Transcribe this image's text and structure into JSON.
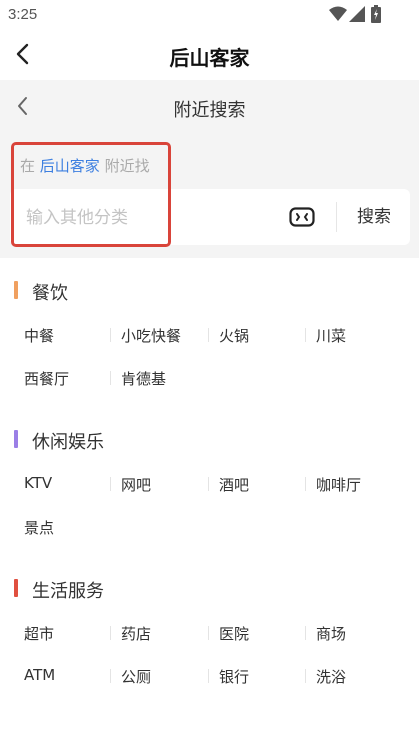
{
  "status_bar": {
    "time": "3:25",
    "icons": [
      "wifi-icon",
      "signal-icon",
      "battery-icon"
    ]
  },
  "title_bar": {
    "title": "后山客家",
    "back_icon": "chevron-left-icon"
  },
  "sub_header": {
    "title": "附近搜索",
    "back_icon": "chevron-left-icon"
  },
  "search": {
    "prefix": "在",
    "place": "后山客家",
    "suffix": "附近找",
    "placeholder": "输入其他分类",
    "value": "",
    "voice_icon": "voice-input-icon",
    "button_label": "搜索"
  },
  "colors": {
    "accent_blue": "#3d7fe0",
    "highlight_red": "#d9443a",
    "dining_bar": "#f0a060",
    "leisure_bar": "#9b7fe6",
    "life_bar": "#e05040"
  },
  "sections": [
    {
      "title": "餐饮",
      "color": "#f0a060",
      "items": [
        "中餐",
        "小吃快餐",
        "火锅",
        "川菜",
        "西餐厅",
        "肯德基"
      ]
    },
    {
      "title": "休闲娱乐",
      "color": "#9b7fe6",
      "items": [
        "KTV",
        "网吧",
        "酒吧",
        "咖啡厅",
        "景点"
      ]
    },
    {
      "title": "生活服务",
      "color": "#e05040",
      "items": [
        "超市",
        "药店",
        "医院",
        "商场",
        "ATM",
        "公厕",
        "银行",
        "洗浴"
      ]
    }
  ]
}
